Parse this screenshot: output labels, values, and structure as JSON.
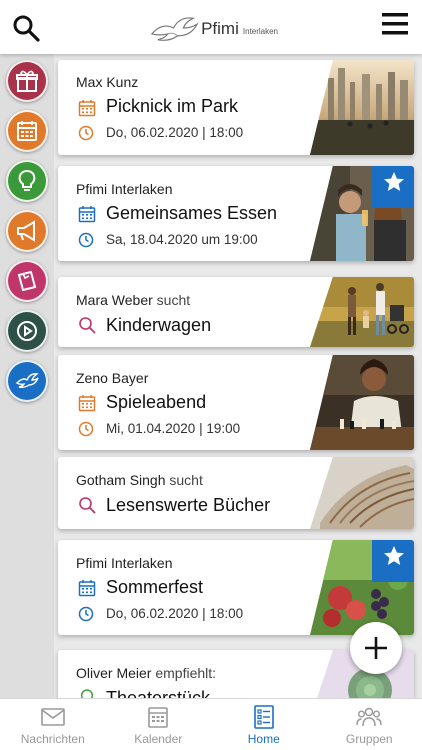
{
  "app": {
    "logo_name": "Pfimi",
    "logo_sub": "Interlaken"
  },
  "colors": {
    "accent_blue": "#1a6fc4",
    "orange": "#e07a2a",
    "magenta": "#c0356a",
    "green": "#3a9a3a"
  },
  "sidebar": {
    "categories": [
      {
        "name": "gift-icon",
        "color": "#a8324a"
      },
      {
        "name": "calendar-icon",
        "color": "#e07a2a"
      },
      {
        "name": "lightbulb-icon",
        "color": "#3a9a3a"
      },
      {
        "name": "megaphone-icon",
        "color": "#e07a2a"
      },
      {
        "name": "note-icon",
        "color": "#c0356a"
      },
      {
        "name": "play-icon",
        "color": "#2e5147"
      },
      {
        "name": "dove-icon",
        "color": "#1a6fc4"
      }
    ]
  },
  "feed": [
    {
      "author": "Max Kunz",
      "verb": "",
      "title": "Picknick im Park",
      "date": "Do, 06.02.2020 | 18:00",
      "type": "event",
      "color": "#e07a2a",
      "starred": false
    },
    {
      "author": "Pfimi Interlaken",
      "verb": "",
      "title": "Gemeinsames Essen",
      "date": "Sa, 18.04.2020 um 19:00",
      "type": "event",
      "color": "#1a6fc4",
      "starred": true
    },
    {
      "author": "Mara Weber",
      "verb": "sucht",
      "title": "Kinderwagen",
      "date": "",
      "type": "search",
      "color": "#c0356a",
      "starred": false
    },
    {
      "author": "Zeno Bayer",
      "verb": "",
      "title": "Spieleabend",
      "date": "Mi, 01.04.2020 | 19:00",
      "type": "event",
      "color": "#e07a2a",
      "starred": false
    },
    {
      "author": "Gotham Singh",
      "verb": "sucht",
      "title": "Lesenswerte Bücher",
      "date": "",
      "type": "search",
      "color": "#c0356a",
      "starred": false
    },
    {
      "author": "Pfimi Interlaken",
      "verb": "",
      "title": "Sommerfest",
      "date": "Do, 06.02.2020 | 18:00",
      "type": "event",
      "color": "#1a6fc4",
      "starred": true
    },
    {
      "author": "Oliver Meier",
      "verb": "empfiehlt:",
      "title": "Theaterstück",
      "date": "",
      "type": "tip",
      "color": "#3a9a3a",
      "starred": false
    }
  ],
  "fab": {
    "icon": "plus-icon"
  },
  "tabs": [
    {
      "label": "Nachrichten",
      "icon": "mail-icon",
      "active": false
    },
    {
      "label": "Kalender",
      "icon": "calendar-icon",
      "active": false
    },
    {
      "label": "Home",
      "icon": "list-icon",
      "active": true
    },
    {
      "label": "Gruppen",
      "icon": "group-icon",
      "active": false
    }
  ]
}
